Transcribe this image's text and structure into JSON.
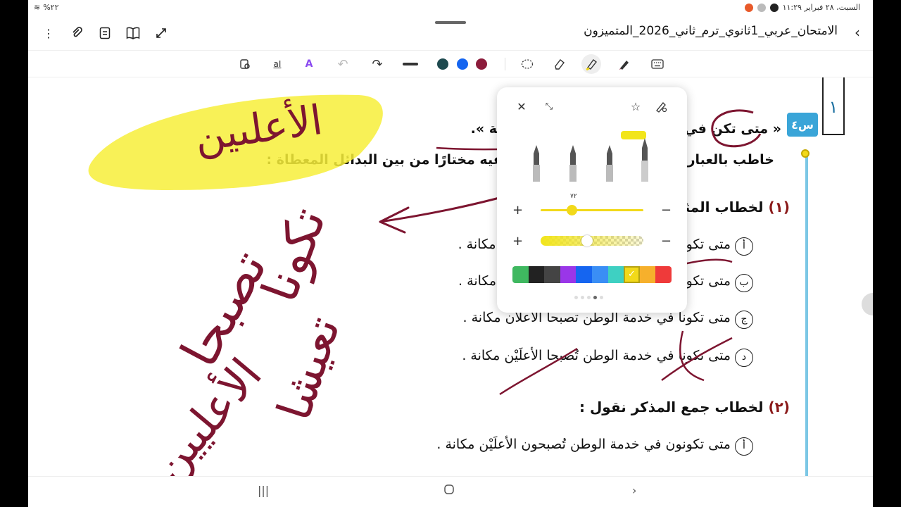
{
  "status_bar": {
    "left_text": "%٢٢",
    "right_text": "السبت، ٢٨ فبراير  ١١:٢٩"
  },
  "header": {
    "title": "الامتحان_عربي_1ثانوي_ترم_ثاني_2026_المتميزون",
    "icons": [
      "more-icon",
      "attach-icon",
      "outline-icon",
      "book-icon",
      "expand-icon"
    ]
  },
  "toolbar": {
    "tools": [
      "lasso-icon",
      "text-box-icon",
      "text-style-icon",
      "undo-icon",
      "redo-icon",
      "line-width-icon",
      "selection-icon",
      "eraser-icon",
      "highlighter-icon",
      "pen-icon",
      "keyboard-icon"
    ],
    "colors": [
      "#1e4a4f",
      "#1565f0",
      "#8c1c3b"
    ]
  },
  "document": {
    "side_number": "١",
    "question_badge": "س٤",
    "heading_line1": "« متى تكن في خدمة الوطن تصبح على مكانة ».",
    "heading_line2": "خاطب بالعبارة السابقة المثنى والجمع بنوعيه مختارًا من بين البدائل المعطاة :",
    "section1_num": "(١)",
    "section1_text": "لخطاب المثنى نقول :",
    "options1": [
      {
        "letter": "أ",
        "text": "متى تكونا في خدمة الوطن تصبحا الأعليَيْن مكانة ."
      },
      {
        "letter": "ب",
        "text": "متى تكونا في خدمة الوطن تصبحا الأعليَان مكانة ."
      },
      {
        "letter": "ج",
        "text": "متى تكونا في خدمة الوطن تصبحا الأعلَان مكانة ."
      },
      {
        "letter": "د",
        "text": "متى تكونا في خدمة الوطن تُصبحا الأعلَيْن مكانة ."
      }
    ],
    "section2_num": "(٢)",
    "section2_text": "لخطاب جمع المذكر نقول :",
    "options2": [
      {
        "letter": "أ",
        "text": "متى تكونون في خدمة الوطن تُصبحون الأعلَيْن مكانة ."
      }
    ]
  },
  "annotations": {
    "highlight_word": "الأعلىين",
    "handwriting_1": "تكونا",
    "handwriting_2": "تصبحا",
    "handwriting_3": "تعيشا",
    "handwriting_4": "الأعليين"
  },
  "pen_popup": {
    "size_value": "٧٢",
    "size_fraction": 0.3,
    "opacity_fraction": 0.45,
    "palette": [
      "#3fb860",
      "#222222",
      "#444444",
      "#9a36e8",
      "#1565f0",
      "#3a8ef5",
      "#3ed0c2",
      "#f2d91a",
      "#f6b02c",
      "#ef3a3a"
    ],
    "selected_color": "#f2d91a"
  }
}
